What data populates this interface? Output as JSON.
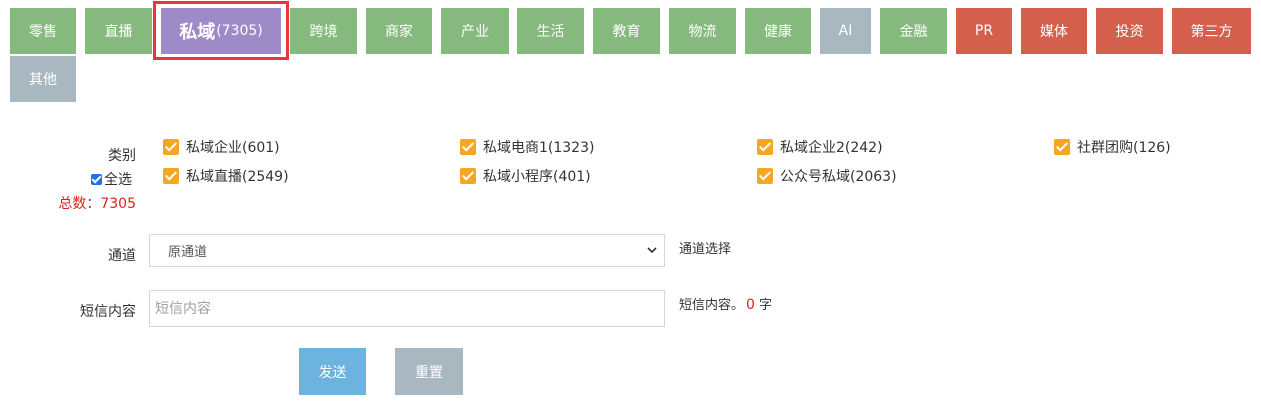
{
  "tabs": [
    {
      "label": "零售",
      "color": "green"
    },
    {
      "label": "直播",
      "color": "green"
    },
    {
      "label": "私域",
      "count": "(7305)",
      "color": "purple",
      "active": true
    },
    {
      "label": "跨境",
      "color": "green"
    },
    {
      "label": "商家",
      "color": "green"
    },
    {
      "label": "产业",
      "color": "green"
    },
    {
      "label": "生活",
      "color": "green"
    },
    {
      "label": "教育",
      "color": "green"
    },
    {
      "label": "物流",
      "color": "green"
    },
    {
      "label": "健康",
      "color": "green"
    },
    {
      "label": "AI",
      "color": "gray"
    },
    {
      "label": "金融",
      "color": "green"
    },
    {
      "label": "PR",
      "color": "red"
    },
    {
      "label": "媒体",
      "color": "red"
    },
    {
      "label": "投资",
      "color": "red"
    },
    {
      "label": "第三方",
      "color": "red"
    },
    {
      "label": "其他",
      "color": "gray"
    }
  ],
  "category": {
    "label": "类别",
    "select_all_label": "全选",
    "select_all_checked": true,
    "total_label": "总数：7305",
    "options": [
      {
        "label": "私域企业(601)",
        "checked": true
      },
      {
        "label": "私域电商1(1323)",
        "checked": true
      },
      {
        "label": "私域企业2(242)",
        "checked": true
      },
      {
        "label": "社群团购(126)",
        "checked": true
      },
      {
        "label": "私域直播(2549)",
        "checked": true
      },
      {
        "label": "私域小程序(401)",
        "checked": true
      },
      {
        "label": "公众号私域(2063)",
        "checked": true
      }
    ]
  },
  "channel": {
    "label": "通道",
    "selected": "原通道",
    "hint": "通道选择"
  },
  "sms": {
    "label": "短信内容",
    "placeholder": "短信内容",
    "value": "",
    "hint_prefix": "短信内容。",
    "char_count": "0",
    "hint_suffix": "字"
  },
  "actions": {
    "send_label": "发送",
    "reset_label": "重置"
  },
  "colors": {
    "green": "#86b97e",
    "gray": "#a9b7c1",
    "red": "#d35f4c",
    "purple": "#9d8ac6",
    "checkbox": "#f5a623",
    "total": "#e02020",
    "send": "#6db3e0"
  }
}
